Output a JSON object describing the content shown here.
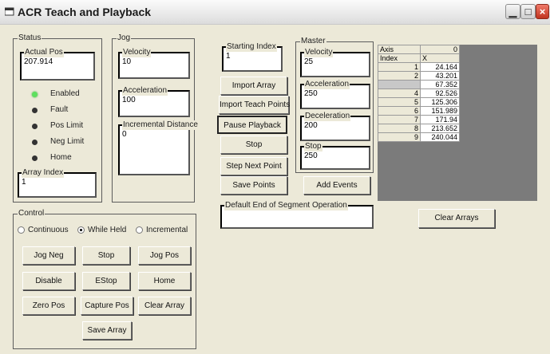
{
  "window": {
    "title": "ACR Teach and Playback"
  },
  "status": {
    "legend": "Status",
    "actual_pos_label": "Actual Pos",
    "actual_pos_value": "207.914",
    "indicators": [
      {
        "label": "Enabled",
        "on": true
      },
      {
        "label": "Fault",
        "on": false
      },
      {
        "label": "Pos Limit",
        "on": false
      },
      {
        "label": "Neg Limit",
        "on": false
      },
      {
        "label": "Home",
        "on": false
      }
    ],
    "array_index_label": "Array Index",
    "array_index_value": "1"
  },
  "jog": {
    "legend": "Jog",
    "velocity_label": "Velocity",
    "velocity_value": "10",
    "acceleration_label": "Acceleration",
    "acceleration_value": "100",
    "incremental_distance_label": "Incremental Distance",
    "incremental_distance_value": "0"
  },
  "control": {
    "legend": "Control",
    "modes": [
      {
        "label": "Continuous",
        "selected": false
      },
      {
        "label": "While Held",
        "selected": true
      },
      {
        "label": "Incremental",
        "selected": false
      }
    ],
    "buttons": {
      "jog_neg": "Jog Neg",
      "stop": "Stop",
      "jog_pos": "Jog Pos",
      "disable": "Disable",
      "estop": "EStop",
      "home": "Home",
      "zero_pos": "Zero Pos",
      "capture_pos": "Capture Pos",
      "clear_array": "Clear Array",
      "save_array": "Save Array"
    }
  },
  "playback": {
    "starting_index_label": "Starting Index",
    "starting_index_value": "1",
    "import_array": "Import Array",
    "import_teach_points": "Import Teach Points",
    "pause_playback": "Pause Playback",
    "stop": "Stop",
    "step_next_point": "Step Next Point",
    "save_points": "Save Points",
    "add_events": "Add Events",
    "default_eos_label": "Default End of Segment Operation",
    "default_eos_value": ""
  },
  "master": {
    "legend": "Master",
    "velocity_label": "Velocity",
    "velocity_value": "25",
    "acceleration_label": "Acceleration",
    "acceleration_value": "250",
    "deceleration_label": "Deceleration",
    "deceleration_value": "200",
    "stop_label": "Stop",
    "stop_value": "250"
  },
  "axis_grid": {
    "axis_label": "Axis",
    "axis_value": "0",
    "index_label": "Index",
    "column_label": "X",
    "rows": [
      {
        "index": "1",
        "x": "24.164"
      },
      {
        "index": "2",
        "x": "43.201"
      },
      {
        "index": "",
        "x": "67.352"
      },
      {
        "index": "4",
        "x": "92.526"
      },
      {
        "index": "5",
        "x": "125.306"
      },
      {
        "index": "6",
        "x": "151.989"
      },
      {
        "index": "7",
        "x": "171.94"
      },
      {
        "index": "8",
        "x": "213.652"
      },
      {
        "index": "9",
        "x": "240.044"
      }
    ]
  },
  "clear_arrays": "Clear Arrays"
}
